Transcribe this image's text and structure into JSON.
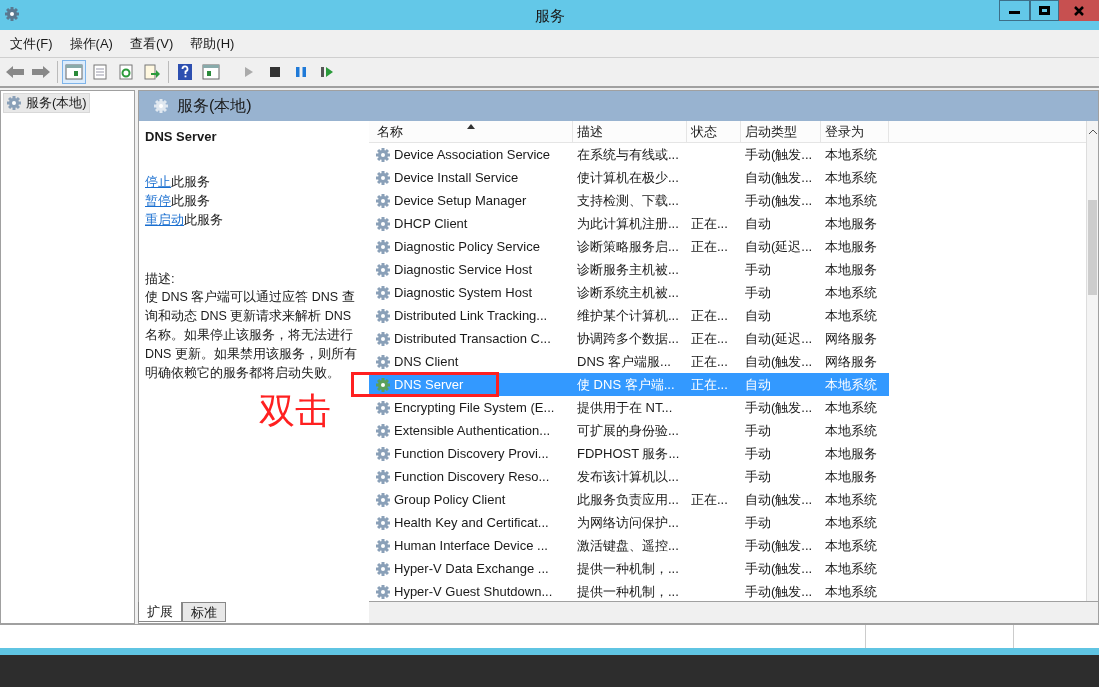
{
  "window": {
    "title": "服务"
  },
  "menu": [
    "文件(F)",
    "操作(A)",
    "查看(V)",
    "帮助(H)"
  ],
  "toolbar": {
    "console_tree_on": true
  },
  "tree": {
    "items": [
      {
        "label": "服务(本地)",
        "selected": true
      }
    ]
  },
  "panel": {
    "title": "服务(本地)"
  },
  "details": {
    "service_name": "DNS Server",
    "actions": [
      {
        "link": "停止",
        "text": "此服务"
      },
      {
        "link": "暂停",
        "text": "此服务"
      },
      {
        "link": "重启动",
        "text": "此服务"
      }
    ],
    "description_label": "描述:",
    "description": "使 DNS 客户端可以通过应答 DNS 查询和动态 DNS 更新请求来解析 DNS 名称。如果停止该服务，将无法进行 DNS 更新。如果禁用该服务，则所有明确依赖它的服务都将启动失败。"
  },
  "table": {
    "columns": [
      "名称",
      "描述",
      "状态",
      "启动类型",
      "登录为"
    ],
    "rows": [
      {
        "name": "Device Association Service",
        "description": "在系统与有线或...",
        "status": "",
        "startup": "手动(触发...",
        "logon": "本地系统",
        "selected": false
      },
      {
        "name": "Device Install Service",
        "description": "使计算机在极少...",
        "status": "",
        "startup": "自动(触发...",
        "logon": "本地系统",
        "selected": false
      },
      {
        "name": "Device Setup Manager",
        "description": "支持检测、下载...",
        "status": "",
        "startup": "手动(触发...",
        "logon": "本地系统",
        "selected": false
      },
      {
        "name": "DHCP Client",
        "description": "为此计算机注册...",
        "status": "正在...",
        "startup": "自动",
        "logon": "本地服务",
        "selected": false
      },
      {
        "name": "Diagnostic Policy Service",
        "description": "诊断策略服务启...",
        "status": "正在...",
        "startup": "自动(延迟...",
        "logon": "本地服务",
        "selected": false
      },
      {
        "name": "Diagnostic Service Host",
        "description": "诊断服务主机被...",
        "status": "",
        "startup": "手动",
        "logon": "本地服务",
        "selected": false
      },
      {
        "name": "Diagnostic System Host",
        "description": "诊断系统主机被...",
        "status": "",
        "startup": "手动",
        "logon": "本地系统",
        "selected": false
      },
      {
        "name": "Distributed Link Tracking...",
        "description": "维护某个计算机...",
        "status": "正在...",
        "startup": "自动",
        "logon": "本地系统",
        "selected": false
      },
      {
        "name": "Distributed Transaction C...",
        "description": "协调跨多个数据...",
        "status": "正在...",
        "startup": "自动(延迟...",
        "logon": "网络服务",
        "selected": false
      },
      {
        "name": "DNS Client",
        "description": "DNS 客户端服...",
        "status": "正在...",
        "startup": "自动(触发...",
        "logon": "网络服务",
        "selected": false
      },
      {
        "name": "DNS Server",
        "description": "使 DNS 客户端...",
        "status": "正在...",
        "startup": "自动",
        "logon": "本地系统",
        "selected": true
      },
      {
        "name": "Encrypting File System (E...",
        "description": "提供用于在 NT...",
        "status": "",
        "startup": "手动(触发...",
        "logon": "本地系统",
        "selected": false
      },
      {
        "name": "Extensible Authentication...",
        "description": "可扩展的身份验...",
        "status": "",
        "startup": "手动",
        "logon": "本地系统",
        "selected": false
      },
      {
        "name": "Function Discovery Provi...",
        "description": "FDPHOST 服务...",
        "status": "",
        "startup": "手动",
        "logon": "本地服务",
        "selected": false
      },
      {
        "name": "Function Discovery Reso...",
        "description": "发布该计算机以...",
        "status": "",
        "startup": "手动",
        "logon": "本地服务",
        "selected": false
      },
      {
        "name": "Group Policy Client",
        "description": "此服务负责应用...",
        "status": "正在...",
        "startup": "自动(触发...",
        "logon": "本地系统",
        "selected": false
      },
      {
        "name": "Health Key and Certificat...",
        "description": "为网络访问保护...",
        "status": "",
        "startup": "手动",
        "logon": "本地系统",
        "selected": false
      },
      {
        "name": "Human Interface Device ...",
        "description": "激活键盘、遥控...",
        "status": "",
        "startup": "手动(触发...",
        "logon": "本地系统",
        "selected": false
      },
      {
        "name": "Hyper-V Data Exchange ...",
        "description": "提供一种机制，...",
        "status": "",
        "startup": "手动(触发...",
        "logon": "本地系统",
        "selected": false
      },
      {
        "name": "Hyper-V Guest Shutdown...",
        "description": "提供一种机制，...",
        "status": "",
        "startup": "手动(触发...",
        "logon": "本地系统",
        "selected": false
      }
    ]
  },
  "view_tabs": [
    {
      "label": "扩展",
      "selected": true
    },
    {
      "label": "标准",
      "selected": false
    }
  ],
  "annotation": {
    "text": "双击"
  }
}
